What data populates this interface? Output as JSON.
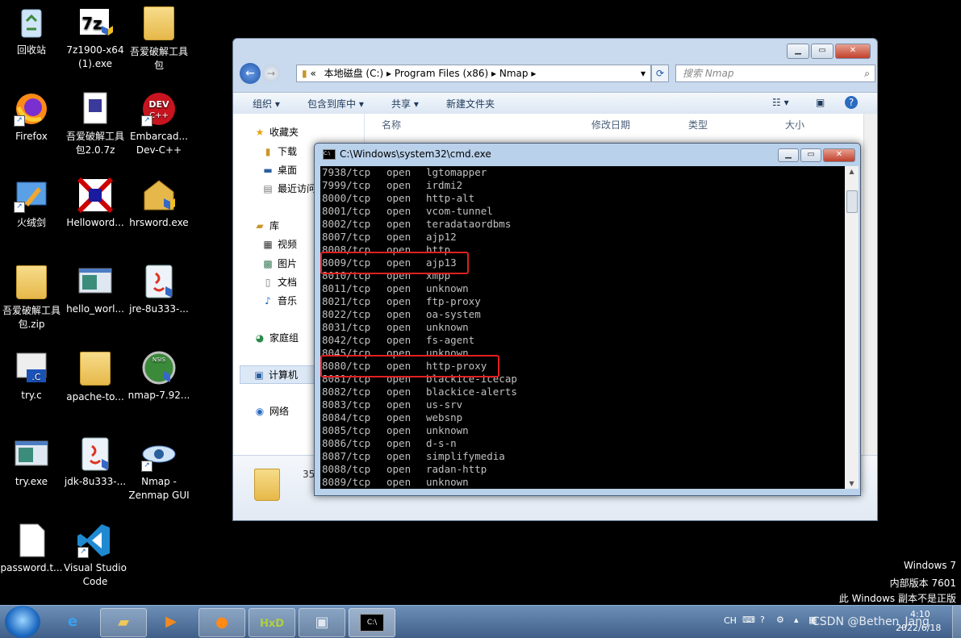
{
  "desktop": {
    "icons": [
      {
        "label": "回收站"
      },
      {
        "label": "7z1900-x64 (1).exe"
      },
      {
        "label": "吾爱破解工具包"
      },
      {
        "label": "Firefox"
      },
      {
        "label": "吾爱破解工具包2.0.7z"
      },
      {
        "label": "Embarcad... Dev-C++"
      },
      {
        "label": "火绒剑"
      },
      {
        "label": "Helloword..."
      },
      {
        "label": "hrsword.exe"
      },
      {
        "label": "吾爱破解工具包.zip"
      },
      {
        "label": "hello_worl..."
      },
      {
        "label": "jre-8u333-..."
      },
      {
        "label": "try.c"
      },
      {
        "label": "apache-to..."
      },
      {
        "label": "nmap-7.92..."
      },
      {
        "label": "try.exe"
      },
      {
        "label": "jdk-8u333-..."
      },
      {
        "label": "Nmap - Zenmap GUI"
      },
      {
        "label": "password.t..."
      },
      {
        "label": "Visual Studio Code"
      }
    ]
  },
  "explorer": {
    "breadcrumb": [
      "«",
      "本地磁盘 (C:)",
      "Program Files (x86)",
      "Nmap"
    ],
    "search_placeholder": "搜索 Nmap",
    "toolbar": {
      "organize": "组织 ▾",
      "include": "包含到库中 ▾",
      "share": "共享 ▾",
      "new_folder": "新建文件夹"
    },
    "columns": {
      "name": "名称",
      "modified": "修改日期",
      "type": "类型",
      "size": "大小"
    },
    "nav": {
      "favorites": "收藏夹",
      "downloads": "下载",
      "desktop": "桌面",
      "recent": "最近访问",
      "libraries": "库",
      "videos": "视频",
      "pictures": "图片",
      "documents": "文档",
      "music": "音乐",
      "homegroup": "家庭组",
      "computer": "计算机",
      "network": "网络"
    },
    "details_count": "35"
  },
  "cmd": {
    "title": "C:\\Windows\\system32\\cmd.exe",
    "lines": [
      {
        "port": "7938/tcp",
        "state": "open",
        "service": "lgtomapper"
      },
      {
        "port": "7999/tcp",
        "state": "open",
        "service": "irdmi2"
      },
      {
        "port": "8000/tcp",
        "state": "open",
        "service": "http-alt"
      },
      {
        "port": "8001/tcp",
        "state": "open",
        "service": "vcom-tunnel"
      },
      {
        "port": "8002/tcp",
        "state": "open",
        "service": "teradataordbms"
      },
      {
        "port": "8007/tcp",
        "state": "open",
        "service": "ajp12"
      },
      {
        "port": "8008/tcp",
        "state": "open",
        "service": "http"
      },
      {
        "port": "8009/tcp",
        "state": "open",
        "service": "ajp13"
      },
      {
        "port": "8010/tcp",
        "state": "open",
        "service": "xmpp"
      },
      {
        "port": "8011/tcp",
        "state": "open",
        "service": "unknown"
      },
      {
        "port": "8021/tcp",
        "state": "open",
        "service": "ftp-proxy"
      },
      {
        "port": "8022/tcp",
        "state": "open",
        "service": "oa-system"
      },
      {
        "port": "8031/tcp",
        "state": "open",
        "service": "unknown"
      },
      {
        "port": "8042/tcp",
        "state": "open",
        "service": "fs-agent"
      },
      {
        "port": "8045/tcp",
        "state": "open",
        "service": "unknown"
      },
      {
        "port": "8080/tcp",
        "state": "open",
        "service": "http-proxy"
      },
      {
        "port": "8081/tcp",
        "state": "open",
        "service": "blackice-icecap"
      },
      {
        "port": "8082/tcp",
        "state": "open",
        "service": "blackice-alerts"
      },
      {
        "port": "8083/tcp",
        "state": "open",
        "service": "us-srv"
      },
      {
        "port": "8084/tcp",
        "state": "open",
        "service": "websnp"
      },
      {
        "port": "8085/tcp",
        "state": "open",
        "service": "unknown"
      },
      {
        "port": "8086/tcp",
        "state": "open",
        "service": "d-s-n"
      },
      {
        "port": "8087/tcp",
        "state": "open",
        "service": "simplifymedia"
      },
      {
        "port": "8088/tcp",
        "state": "open",
        "service": "radan-http"
      },
      {
        "port": "8089/tcp",
        "state": "open",
        "service": "unknown"
      }
    ],
    "highlight_color": "#e02020"
  },
  "watermark": {
    "line1": "Windows 7",
    "line2": "内部版本 7601",
    "line3": "此 Windows 副本不是正版"
  },
  "tray": {
    "lang": "CH",
    "time": "4:10",
    "date": "2022/6/18",
    "credit": "CSDN @Bethen_Jang"
  }
}
